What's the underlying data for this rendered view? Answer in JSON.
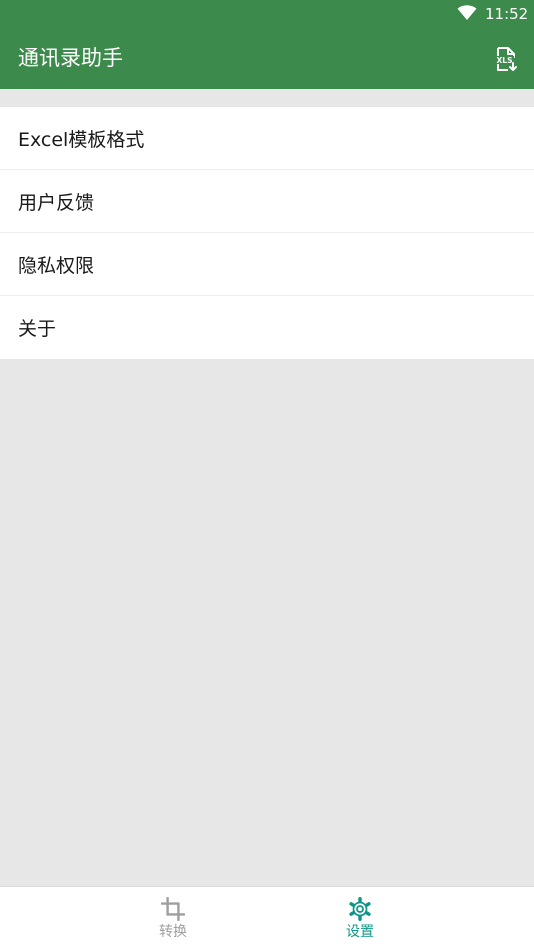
{
  "status_bar": {
    "time": "11:52",
    "wifi_icon": "wifi-icon"
  },
  "app_bar": {
    "title": "通讯录助手",
    "action_icon": "xls-export-icon",
    "action_icon_text": "XLS"
  },
  "settings": {
    "items": [
      {
        "label": "Excel模板格式"
      },
      {
        "label": "用户反馈"
      },
      {
        "label": "隐私权限"
      },
      {
        "label": "关于"
      }
    ]
  },
  "bottom_nav": {
    "tabs": [
      {
        "label": "转换",
        "icon": "crop-icon",
        "active": false
      },
      {
        "label": "设置",
        "icon": "gear-icon",
        "active": true
      }
    ]
  },
  "colors": {
    "primary": "#3d8b4c",
    "accent": "#109688",
    "inactive": "#9e9e9e",
    "background": "#e7e7e7"
  }
}
